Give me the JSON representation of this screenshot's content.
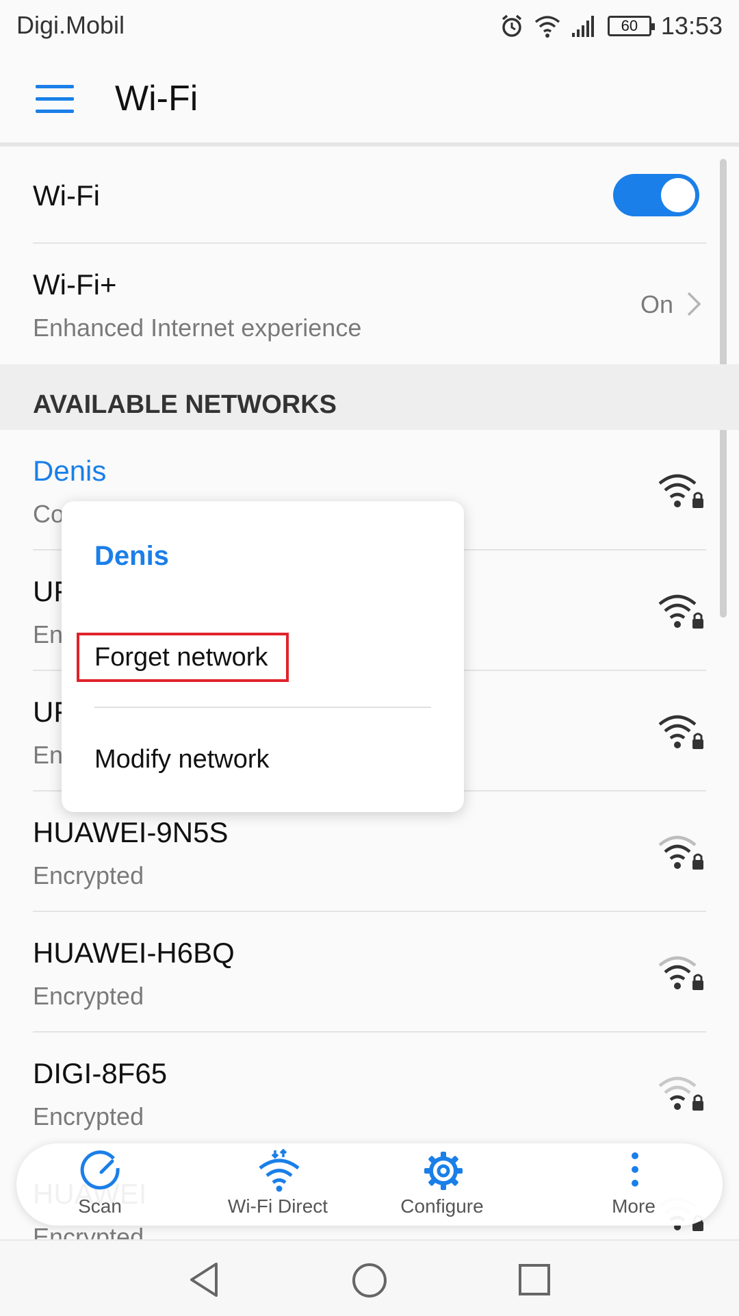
{
  "status_bar": {
    "carrier": "Digi.Mobil",
    "battery": "60",
    "time": "13:53"
  },
  "app_bar": {
    "title": "Wi-Fi"
  },
  "settings": {
    "wifi": {
      "label": "Wi-Fi",
      "enabled": true
    },
    "wifi_plus": {
      "label": "Wi-Fi+",
      "subtitle": "Enhanced Internet experience",
      "value": "On"
    }
  },
  "section_header": "AVAILABLE NETWORKS",
  "networks": [
    {
      "name": "Denis",
      "status": "Co",
      "signal": "strong",
      "locked": true
    },
    {
      "name": "UF",
      "status": "En",
      "signal": "strong",
      "locked": true
    },
    {
      "name": "UF",
      "status": "En",
      "signal": "strong",
      "locked": true
    },
    {
      "name": "HUAWEI-9N5S",
      "status": "Encrypted",
      "signal": "medium",
      "locked": true
    },
    {
      "name": "HUAWEI-H6BQ",
      "status": "Encrypted",
      "signal": "medium",
      "locked": true
    },
    {
      "name": "DIGI-8F65",
      "status": "Encrypted",
      "signal": "weak",
      "locked": true
    },
    {
      "name": "HUAWEI",
      "status": "Encrypted",
      "signal": "weak",
      "locked": true
    }
  ],
  "popup": {
    "title": "Denis",
    "forget_label": "Forget network",
    "modify_label": "Modify network"
  },
  "toolbar": {
    "scan": "Scan",
    "wifi_direct": "Wi-Fi Direct",
    "configure": "Configure",
    "more": "More"
  },
  "colors": {
    "accent": "#1a7fe8",
    "highlight_box": "#e0222b"
  }
}
